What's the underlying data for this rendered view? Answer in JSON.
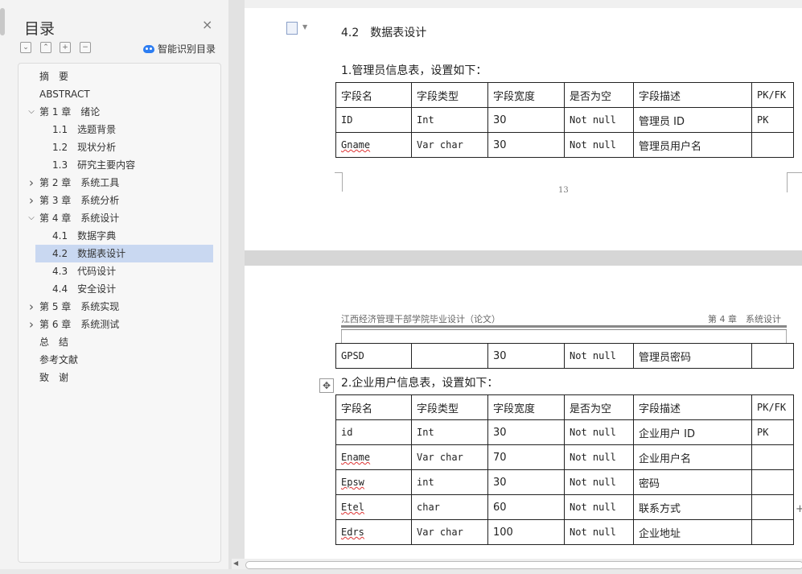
{
  "nav": {
    "title": "目录",
    "close_glyph": "×",
    "tools": [
      "⌄",
      "⌃",
      "+",
      "−"
    ],
    "smart_toc_label": "智能识别目录",
    "items": [
      {
        "label": "摘　要",
        "level": 0
      },
      {
        "label": "ABSTRACT",
        "level": 0
      },
      {
        "label": "第 1 章　绪论",
        "level": 0,
        "expander": "expanded"
      },
      {
        "label": "1.1　选题背景",
        "level": 1
      },
      {
        "label": "1.2　现状分析",
        "level": 1
      },
      {
        "label": "1.3　研究主要内容",
        "level": 1
      },
      {
        "label": "第 2 章　系统工具",
        "level": 0,
        "expander": "collapsed"
      },
      {
        "label": "第 3 章　系统分析",
        "level": 0,
        "expander": "collapsed"
      },
      {
        "label": "第 4 章　系统设计",
        "level": 0,
        "expander": "expanded"
      },
      {
        "label": "4.1　数据字典",
        "level": 1
      },
      {
        "label": "4.2　数据表设计",
        "level": 1,
        "selected": true
      },
      {
        "label": "4.3　代码设计",
        "level": 1
      },
      {
        "label": "4.4　安全设计",
        "level": 1
      },
      {
        "label": "第 5 章　系统实现",
        "level": 0,
        "expander": "collapsed"
      },
      {
        "label": "第 6 章　系统测试",
        "level": 0,
        "expander": "collapsed"
      },
      {
        "label": "总　结",
        "level": 0
      },
      {
        "label": "参考文献",
        "level": 0
      },
      {
        "label": "致　谢",
        "level": 0
      }
    ]
  },
  "doc": {
    "section_heading": "4.2　数据表设计",
    "table1_caption": "1.管理员信息表，设置如下：",
    "table1_header": [
      "字段名",
      "字段类型",
      "字段宽度",
      "是否为空",
      "字段描述",
      "PK/FK"
    ],
    "table1_rows": [
      [
        "ID",
        "Int",
        "30",
        "Not null",
        "管理员 ID",
        "PK"
      ],
      [
        "Gname",
        "Var char",
        "30",
        "Not null",
        "管理员用户名",
        ""
      ]
    ],
    "page_number": "13",
    "running_header_left": "江西经济管理干部学院毕业设计（论文）",
    "running_header_right": "第 4 章　系统设计",
    "table1_cont_rows": [
      [
        "GPSD",
        "",
        "30",
        "Not null",
        "管理员密码",
        ""
      ]
    ],
    "table2_caption": "2.企业用户信息表，设置如下：",
    "table2_header": [
      "字段名",
      "字段类型",
      "字段宽度",
      "是否为空",
      "字段描述",
      "PK/FK"
    ],
    "table2_rows": [
      [
        "id",
        "Int",
        "30",
        "Not null",
        "企业用户 ID",
        "PK"
      ],
      [
        "Ename",
        "Var char",
        "70",
        "Not null",
        "企业用户名",
        ""
      ],
      [
        "Epsw",
        "int",
        "30",
        "Not null",
        "密码",
        ""
      ],
      [
        "Etel",
        "char",
        "60",
        "Not null",
        "联系方式",
        ""
      ],
      [
        "Edrs",
        "Var char",
        "100",
        "Not null",
        "企业地址",
        ""
      ]
    ]
  },
  "colors": {
    "selection": "#c9d8f1",
    "accent": "#2c7df2",
    "spellcheck": "#d33333"
  }
}
